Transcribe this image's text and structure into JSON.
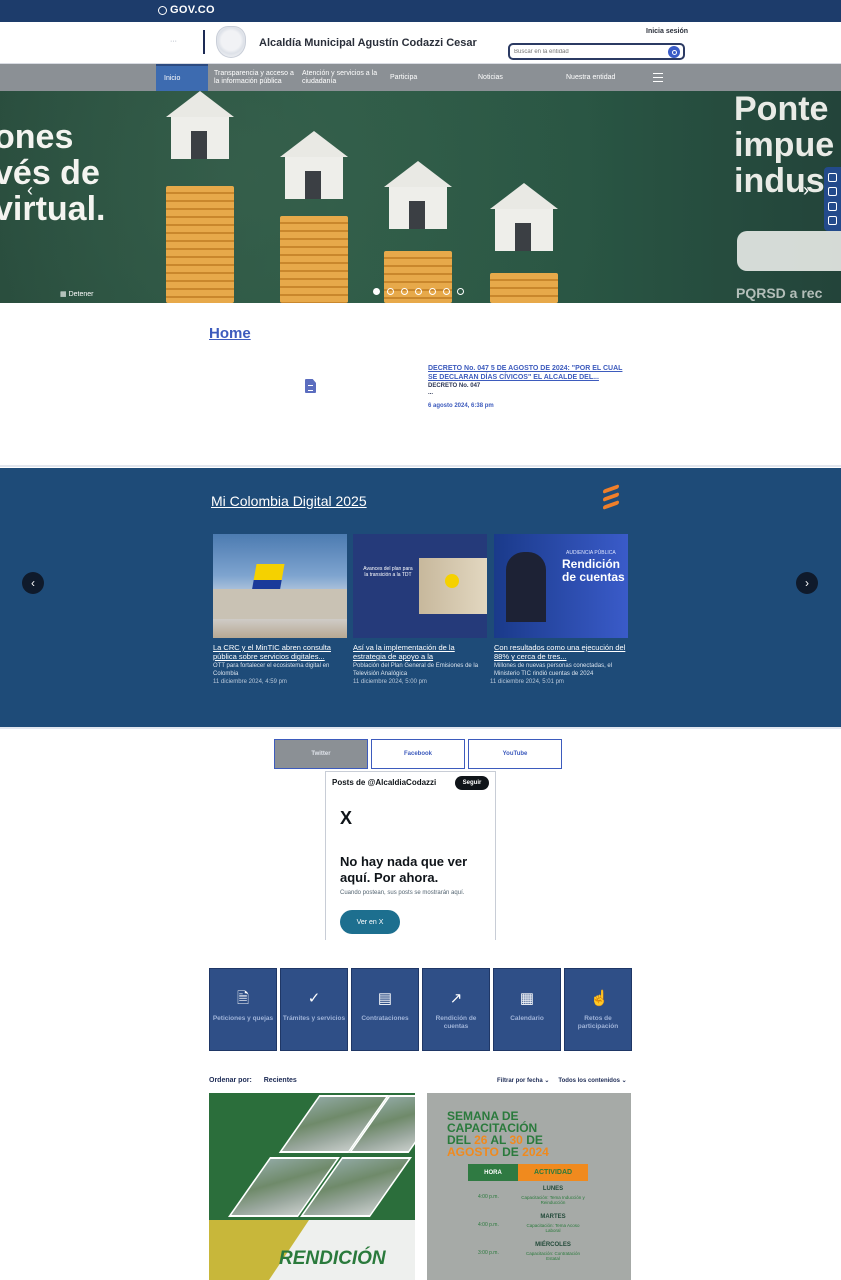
{
  "gov_bar": {
    "logo": "GOV.CO"
  },
  "header": {
    "lang": "···",
    "entity": "Alcaldía Municipal Agustín Codazzi Cesar",
    "login": "Inicia sesión",
    "search_placeholder": "Buscar en la entidad"
  },
  "nav": {
    "items": [
      "Inicio",
      "Transparencia y acceso a la información pública",
      "Atención y servicios a la ciudadanía",
      "Participa",
      "Noticias",
      "Nuestra entidad"
    ]
  },
  "hero": {
    "left_lines": [
      "ones",
      "vés de",
      "virtual."
    ],
    "right_lines": [
      "Ponte",
      "impue",
      "indus"
    ],
    "pqrsd": "PQRSD a rec",
    "stop_label": "Detener",
    "slides_total": 7,
    "slide_active": 1
  },
  "home": {
    "title": "Home",
    "news_title": "DECRETO No. 047 5 DE AGOSTO DE 2024: \"POR EL CUAL SE DECLARAN DÍAS CÍVICOS\" EL ALCALDE DEL...",
    "news_subtitle": "DECRETO No. 047",
    "news_ellipsis": "...",
    "news_date": "6 agosto 2024, 6:38 pm"
  },
  "mcd": {
    "title": "Mi Colombia Digital 2025",
    "cards": [
      {
        "title": "La CRC y el MinTIC abren consulta pública sobre servicios digitales...",
        "summary": "OTT para fortalecer el ecosistema digital en Colombia",
        "date": "11 diciembre 2024, 4:59 pm"
      },
      {
        "title": "Así va la implementación de la estrategia de apoyo a la",
        "summary": "Población del Plan General de Emisiones de la Televisión Analógica",
        "date": "11 diciembre 2024, 5:00 pm",
        "image_text": "Avances del plan para la transición a la TDT"
      },
      {
        "title": "Con resultados como una ejecución del 88% y cerca de tres...",
        "summary": "Millones de nuevas personas conectadas, el Ministerio TIC rindió cuentas de 2024",
        "date": "11 diciembre 2024, 5:01 pm",
        "image_text_small": "AUDIENCIA PÚBLICA",
        "image_text_big": "Rendición de cuentas"
      }
    ]
  },
  "social": {
    "tabs": [
      "Twitter",
      "Facebook",
      "YouTube"
    ],
    "active_tab": "Twitter",
    "header": "Posts de @AlcaldiaCodazzi",
    "follow": "Seguir",
    "x_logo": "X",
    "empty_title": "No hay nada que ver aquí. Por ahora.",
    "empty_sub": "Cuando postean, sus posts se mostrarán aquí.",
    "see_on_x": "Ver en X"
  },
  "quick_access": [
    {
      "label": "Peticiones y quejas",
      "icon": "document-icon"
    },
    {
      "label": "Trámites y servicios",
      "icon": "check-icon"
    },
    {
      "label": "Contrataciones",
      "icon": "checklist-icon"
    },
    {
      "label": "Rendición de cuentas",
      "icon": "chart-icon"
    },
    {
      "label": "Calendario",
      "icon": "calendar-icon"
    },
    {
      "label": "Retos de participación",
      "icon": "hand-pointer-icon"
    }
  ],
  "sort": {
    "label": "Ordenar por:",
    "value": "Recientes",
    "filter_date": "Filtrar por fecha",
    "filter_content": "Todos los contenidos"
  },
  "bottom_cards": {
    "card1_text": "RENDICIÓN",
    "card2": {
      "line1": "SEMANA DE",
      "line2": "CAPACITACIÓN",
      "line3_a": "DEL ",
      "line3_b": "26",
      "line3_c": " AL ",
      "line3_d": "30",
      "line3_e": " DE",
      "line4_a": "AGOSTO",
      "line4_b": " DE ",
      "line4_c": "2024",
      "th_hour": "HORA",
      "th_activity": "ACTIVIDAD",
      "rows": [
        {
          "hour": "4:00 p.m.",
          "day": "LUNES",
          "text": "Capacitación: Tema Inducción y Reinducción"
        },
        {
          "hour": "4:00 p.m.",
          "day": "MARTES",
          "text": "Capacitación: Tema Acoso Laboral"
        },
        {
          "hour": "3:00 p.m.",
          "day": "MIÉRCOLES",
          "text": "Capacitación: Contratación Estatal"
        }
      ]
    }
  },
  "colors": {
    "gov_bar": "#1d3c6b",
    "nav": "#8b9095",
    "accent": "#3d5bbd",
    "mcd_bg": "#1e4b78",
    "quick_access": "#2f4f87"
  }
}
